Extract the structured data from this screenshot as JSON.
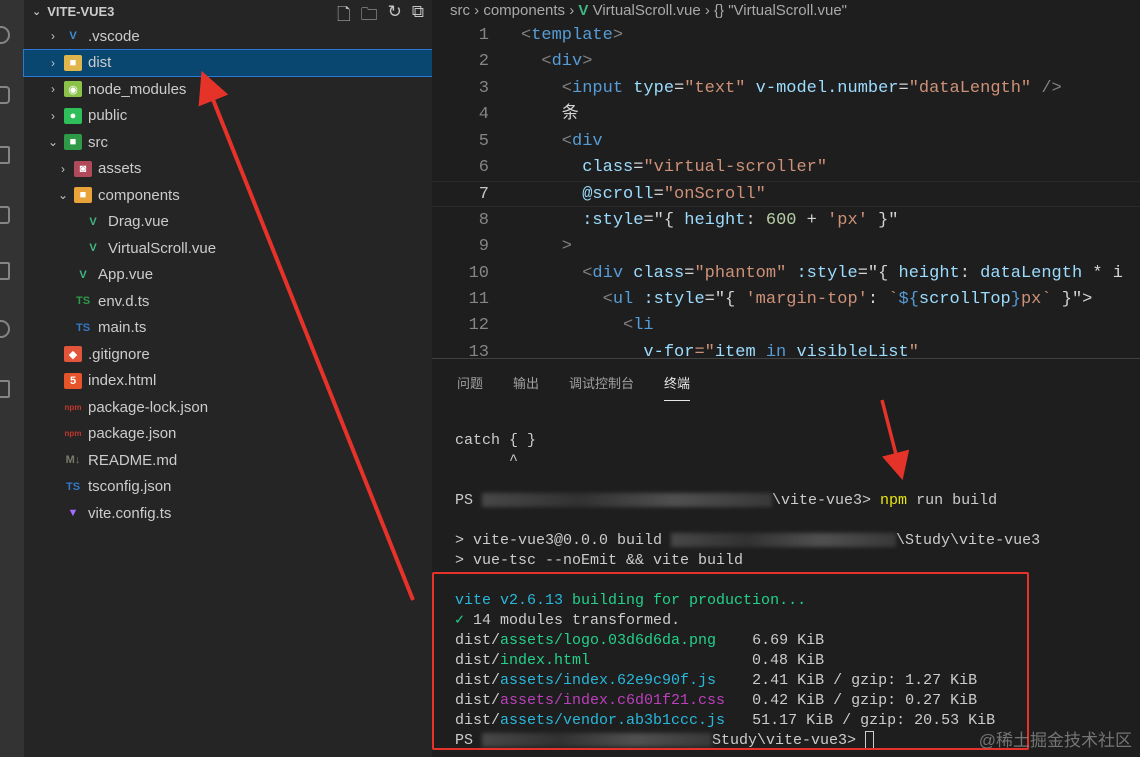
{
  "explorer": {
    "title": "VITE-VUE3",
    "actions": [
      "new-file-icon",
      "new-folder-icon",
      "refresh-icon",
      "collapse-all-icon"
    ],
    "items": [
      {
        "label": ".vscode",
        "depth": 0,
        "type": "folder",
        "expanded": false,
        "icon": "V",
        "color": "#3f8fd8"
      },
      {
        "label": "dist",
        "depth": 0,
        "type": "folder",
        "expanded": false,
        "icon": "■",
        "color": "#e0b64c",
        "selected": true
      },
      {
        "label": "node_modules",
        "depth": 0,
        "type": "folder",
        "expanded": false,
        "icon": "◉",
        "color": "#8bc34a"
      },
      {
        "label": "public",
        "depth": 0,
        "type": "folder",
        "expanded": false,
        "icon": "●",
        "color": "#2fbf5a"
      },
      {
        "label": "src",
        "depth": 0,
        "type": "folder",
        "expanded": true,
        "icon": "■",
        "color": "#2e9a48"
      },
      {
        "label": "assets",
        "depth": 1,
        "type": "folder",
        "expanded": false,
        "icon": "◙",
        "color": "#b04a5a"
      },
      {
        "label": "components",
        "depth": 1,
        "type": "folder",
        "expanded": true,
        "icon": "■",
        "color": "#e8a33a"
      },
      {
        "label": "Drag.vue",
        "depth": 2,
        "type": "file",
        "icon": "V",
        "color": "#41b883"
      },
      {
        "label": "VirtualScroll.vue",
        "depth": 2,
        "type": "file",
        "icon": "V",
        "color": "#41b883"
      },
      {
        "label": "App.vue",
        "depth": 1,
        "type": "file",
        "icon": "V",
        "color": "#41b883"
      },
      {
        "label": "env.d.ts",
        "depth": 1,
        "type": "file",
        "icon": "TS",
        "color": "#2e9a48"
      },
      {
        "label": "main.ts",
        "depth": 1,
        "type": "file",
        "icon": "TS",
        "color": "#3178c6"
      },
      {
        "label": ".gitignore",
        "depth": 0,
        "type": "file",
        "icon": "◆",
        "color": "#e2553a"
      },
      {
        "label": "index.html",
        "depth": 0,
        "type": "file",
        "icon": "5",
        "color": "#e5542a"
      },
      {
        "label": "package-lock.json",
        "depth": 0,
        "type": "file",
        "icon": "npm",
        "color": "#c0392b"
      },
      {
        "label": "package.json",
        "depth": 0,
        "type": "file",
        "icon": "npm",
        "color": "#c0392b"
      },
      {
        "label": "README.md",
        "depth": 0,
        "type": "file",
        "icon": "M↓",
        "color": "#7a7a6a"
      },
      {
        "label": "tsconfig.json",
        "depth": 0,
        "type": "file",
        "icon": "TS",
        "color": "#3178c6"
      },
      {
        "label": "vite.config.ts",
        "depth": 0,
        "type": "file",
        "icon": "▼",
        "color": "#a56bff"
      }
    ]
  },
  "breadcrumb": {
    "parts": [
      "src",
      "components"
    ],
    "file": "VirtualScroll.vue",
    "symbol": "{} \"VirtualScroll.vue\"",
    "sep": "›",
    "vue_glyph": "V"
  },
  "editor": {
    "current_line": 7,
    "colors": {
      "tag": "#569cd6",
      "punct": "#808080",
      "attr": "#9cdcfe",
      "str": "#ce9178",
      "text": "#d4d4d4",
      "num": "#b5cea8"
    },
    "lines": [
      [
        [
          "<",
          "punct"
        ],
        [
          "template",
          "tag"
        ],
        [
          ">",
          "punct"
        ]
      ],
      [
        [
          "  <",
          "punct"
        ],
        [
          "div",
          "tag"
        ],
        [
          ">",
          "punct"
        ]
      ],
      [
        [
          "    <",
          "punct"
        ],
        [
          "input",
          "tag"
        ],
        [
          " ",
          "text"
        ],
        [
          "type",
          "attr"
        ],
        [
          "=",
          "text"
        ],
        [
          "\"text\"",
          "str"
        ],
        [
          " ",
          "text"
        ],
        [
          "v-model.number",
          "attr"
        ],
        [
          "=",
          "text"
        ],
        [
          "\"dataLength\"",
          "str"
        ],
        [
          " />",
          "punct"
        ]
      ],
      [
        [
          "    条",
          "text"
        ]
      ],
      [
        [
          "    <",
          "punct"
        ],
        [
          "div",
          "tag"
        ]
      ],
      [
        [
          "      ",
          "text"
        ],
        [
          "class",
          "attr"
        ],
        [
          "=",
          "text"
        ],
        [
          "\"virtual-scroller\"",
          "str"
        ]
      ],
      [
        [
          "      ",
          "text"
        ],
        [
          "@scroll",
          "attr"
        ],
        [
          "=",
          "text"
        ],
        [
          "\"onScroll\"",
          "str"
        ]
      ],
      [
        [
          "      ",
          "text"
        ],
        [
          ":style",
          "attr"
        ],
        [
          "=\"{ ",
          "text"
        ],
        [
          "height",
          "attr"
        ],
        [
          ": ",
          "text"
        ],
        [
          "600",
          "num"
        ],
        [
          " + ",
          "text"
        ],
        [
          "'px'",
          "str"
        ],
        [
          " }\"",
          "text"
        ]
      ],
      [
        [
          "    >",
          "punct"
        ]
      ],
      [
        [
          "      <",
          "punct"
        ],
        [
          "div",
          "tag"
        ],
        [
          " ",
          "text"
        ],
        [
          "class",
          "attr"
        ],
        [
          "=",
          "text"
        ],
        [
          "\"phantom\"",
          "str"
        ],
        [
          " ",
          "text"
        ],
        [
          ":style",
          "attr"
        ],
        [
          "=\"{ ",
          "text"
        ],
        [
          "height",
          "attr"
        ],
        [
          ": ",
          "text"
        ],
        [
          "dataLength",
          "attr"
        ],
        [
          " * i",
          "text"
        ]
      ],
      [
        [
          "        <",
          "punct"
        ],
        [
          "ul",
          "tag"
        ],
        [
          " ",
          "text"
        ],
        [
          ":style",
          "attr"
        ],
        [
          "=\"{ ",
          "text"
        ],
        [
          "'margin-top'",
          "str"
        ],
        [
          ": ",
          "text"
        ],
        [
          "`",
          "str"
        ],
        [
          "${",
          "tag"
        ],
        [
          "scrollTop",
          "attr"
        ],
        [
          "}",
          "tag"
        ],
        [
          "px`",
          "str"
        ],
        [
          " }\">",
          "text"
        ]
      ],
      [
        [
          "          <",
          "punct"
        ],
        [
          "li",
          "tag"
        ]
      ],
      [
        [
          "            ",
          "text"
        ],
        [
          "v-for",
          "attr"
        ],
        [
          "=\"",
          "str"
        ],
        [
          "item",
          "attr"
        ],
        [
          " in ",
          "tag"
        ],
        [
          "visibleList",
          "attr"
        ],
        [
          "\"",
          "str"
        ]
      ]
    ]
  },
  "panel": {
    "tabs": [
      "问题",
      "输出",
      "调试控制台",
      "终端"
    ],
    "active_tab": 3
  },
  "terminal": {
    "lines": [
      [
        {
          "t": "catch { }",
          "c": "#cccccc"
        }
      ],
      [
        {
          "t": "      ^",
          "c": "#cccccc"
        }
      ],
      [],
      [
        {
          "t": "PS ",
          "c": "#cccccc"
        },
        {
          "blur": 290
        },
        {
          "t": "\\vite-vue3> ",
          "c": "#cccccc"
        },
        {
          "t": "npm",
          "c": "#e5e510"
        },
        {
          "t": " run build",
          "c": "#cccccc"
        }
      ],
      [],
      [
        {
          "t": "> vite-vue3@0.0.0 build ",
          "c": "#cccccc"
        },
        {
          "blur": 225
        },
        {
          "t": "\\Study\\vite-vue3",
          "c": "#cccccc"
        }
      ],
      [
        {
          "t": "> vue-tsc --noEmit && vite build",
          "c": "#cccccc"
        }
      ],
      [],
      [
        {
          "t": "vite v2.6.13 ",
          "c": "#29b8db"
        },
        {
          "t": "building for production...",
          "c": "#23d18b"
        }
      ],
      [
        {
          "t": "✓",
          "c": "#23d18b"
        },
        {
          "t": " 14 modules transformed.",
          "c": "#cccccc"
        }
      ],
      [
        {
          "t": "dist/",
          "c": "#cccccc"
        },
        {
          "t": "assets/logo.03d6d6da.png",
          "c": "#23d18b"
        },
        {
          "t": "    6.69 KiB",
          "c": "#cccccc"
        }
      ],
      [
        {
          "t": "dist/",
          "c": "#cccccc"
        },
        {
          "t": "index.html",
          "c": "#23d18b"
        },
        {
          "t": "                  0.48 KiB",
          "c": "#cccccc"
        }
      ],
      [
        {
          "t": "dist/",
          "c": "#cccccc"
        },
        {
          "t": "assets/index.62e9c90f.js",
          "c": "#29b8db"
        },
        {
          "t": "    2.41 KiB / gzip: 1.27 KiB",
          "c": "#cccccc"
        }
      ],
      [
        {
          "t": "dist/",
          "c": "#cccccc"
        },
        {
          "t": "assets/index.c6d01f21.css",
          "c": "#bc3fbc"
        },
        {
          "t": "   0.42 KiB / gzip: 0.27 KiB",
          "c": "#cccccc"
        }
      ],
      [
        {
          "t": "dist/",
          "c": "#cccccc"
        },
        {
          "t": "assets/vendor.ab3b1ccc.js",
          "c": "#29b8db"
        },
        {
          "t": "   51.17 KiB / gzip: 20.53 KiB",
          "c": "#cccccc"
        }
      ],
      [
        {
          "t": "PS ",
          "c": "#cccccc"
        },
        {
          "blur": 230
        },
        {
          "t": "Study\\vite-vue3> ",
          "c": "#cccccc"
        },
        {
          "cursor": true
        }
      ]
    ]
  },
  "watermark": "@稀土掘金技术社区",
  "annotation_color": "#e5332a"
}
